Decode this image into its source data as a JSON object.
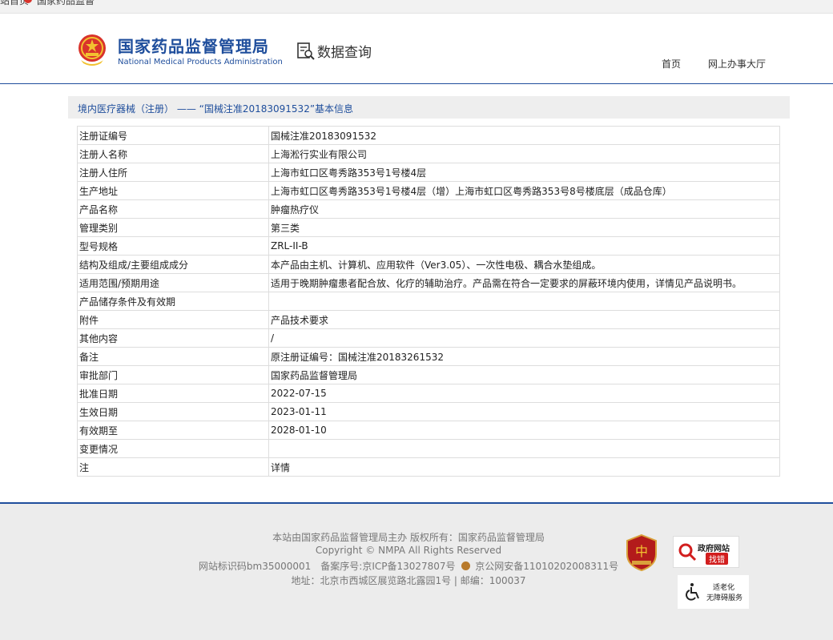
{
  "top_strip": {
    "left_text": "站首页",
    "site_text": "国家药品监督"
  },
  "header": {
    "logo_cn": "国家药品监督管理局",
    "logo_en": "National Medical Products Administration",
    "section_title": "数据查询",
    "nav": [
      "首页",
      "网上办事大厅"
    ]
  },
  "breadcrumb": "境内医疗器械（注册） —— “国械注准20183091532”基本信息",
  "table": {
    "rows": [
      {
        "label": "注册证编号",
        "value": "国械注准20183091532"
      },
      {
        "label": "注册人名称",
        "value": "上海淞行实业有限公司"
      },
      {
        "label": "注册人住所",
        "value": "上海市虹口区粤秀路353号1号楼4层"
      },
      {
        "label": "生产地址",
        "value": "上海市虹口区粤秀路353号1号楼4层（增）上海市虹口区粤秀路353号8号楼底层（成品仓库）"
      },
      {
        "label": "产品名称",
        "value": "肿瘤热疗仪"
      },
      {
        "label": "管理类别",
        "value": "第三类"
      },
      {
        "label": "型号规格",
        "value": "ZRL-II-B"
      },
      {
        "label": "结构及组成/主要组成成分",
        "value": "本产品由主机、计算机、应用软件（Ver3.05）、一次性电极、耦合水垫组成。"
      },
      {
        "label": "适用范围/预期用途",
        "value": "适用于晚期肿瘤患者配合放、化疗的辅助治疗。产品需在符合一定要求的屏蔽环境内使用，详情见产品说明书。"
      },
      {
        "label": "产品储存条件及有效期",
        "value": ""
      },
      {
        "label": "附件",
        "value": "产品技术要求"
      },
      {
        "label": "其他内容",
        "value": "/"
      },
      {
        "label": "备注",
        "value": "原注册证编号：国械注准20183261532"
      },
      {
        "label": "审批部门",
        "value": "国家药品监督管理局"
      },
      {
        "label": "批准日期",
        "value": "2022-07-15"
      },
      {
        "label": "生效日期",
        "value": "2023-01-11"
      },
      {
        "label": "有效期至",
        "value": "2028-01-10"
      },
      {
        "label": "变更情况",
        "value": ""
      },
      {
        "label": "注",
        "value": "详情"
      }
    ]
  },
  "footer": {
    "line1": "本站由国家药品监督管理局主办 版权所有：国家药品监督管理局",
    "line2": "Copyright © NMPA All Rights Reserved",
    "line3_a": "网站标识码bm35000001　备案序号:京ICP备13027807号",
    "line3_b": "京公网安备11010202008311号",
    "line4": "地址：北京市西城区展览路北露园1号 | 邮编：100037",
    "badge_gov_line1": "政府网站",
    "badge_gov_line2": "找错",
    "badge_access_line1": "适老化",
    "badge_access_line2": "无障碍服务"
  },
  "colors": {
    "brand_blue": "#1f4e9c",
    "emblem_red": "#d9332b",
    "gold": "#f2c230"
  }
}
